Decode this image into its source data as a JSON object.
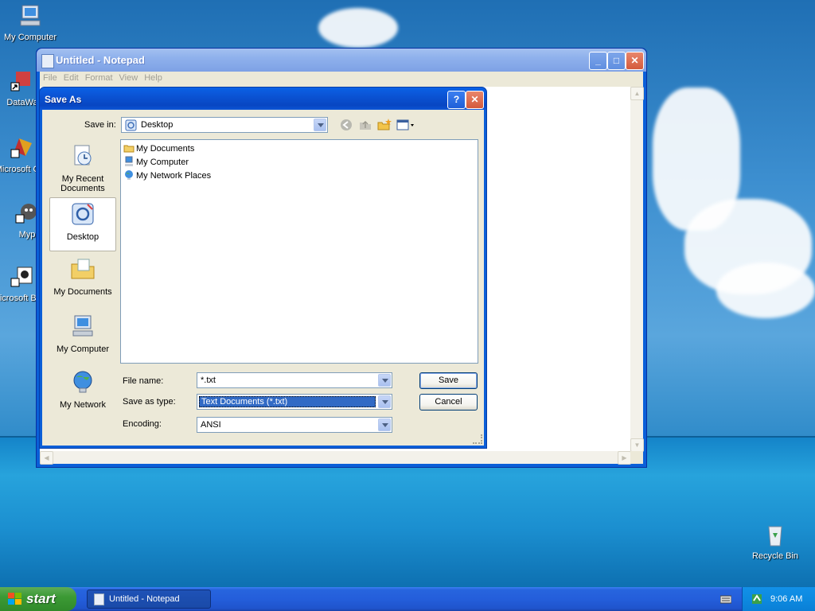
{
  "desktop": {
    "icons": [
      {
        "label": "My Computer"
      },
      {
        "label": "DataWa"
      },
      {
        "label": "Microsoft C++"
      },
      {
        "label": "Myp"
      },
      {
        "label": "Microsoft Basic"
      },
      {
        "label": "Recycle Bin"
      }
    ]
  },
  "notepad": {
    "title": "Untitled - Notepad",
    "menu": [
      "File",
      "Edit",
      "Format",
      "View",
      "Help"
    ]
  },
  "dialog": {
    "title": "Save As",
    "help_button": "?",
    "save_in_label": "Save in:",
    "save_in_value": "Desktop",
    "places": [
      {
        "label": "My Recent Documents"
      },
      {
        "label": "Desktop"
      },
      {
        "label": "My Documents"
      },
      {
        "label": "My Computer"
      },
      {
        "label": "My Network"
      }
    ],
    "files": [
      {
        "name": "My Documents"
      },
      {
        "name": "My Computer"
      },
      {
        "name": "My Network Places"
      }
    ],
    "file_name_label": "File name:",
    "file_name_value": "*.txt",
    "save_type_label": "Save as type:",
    "save_type_value": "Text Documents (*.txt)",
    "encoding_label": "Encoding:",
    "encoding_value": "ANSI",
    "save_button": "Save",
    "cancel_button": "Cancel"
  },
  "taskbar": {
    "start_label": "start",
    "task_label": "Untitled - Notepad",
    "clock": "9:06 AM"
  }
}
